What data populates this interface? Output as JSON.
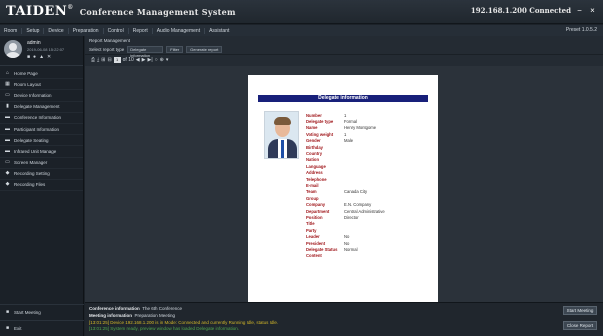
{
  "titlebar": {
    "brand": "TAIDEN",
    "brand_mark": "®",
    "title": "Conference Management System",
    "ip_info": "192.168.1.200  Connected",
    "min_glyph": "−",
    "close_glyph": "×"
  },
  "menubar": {
    "items": [
      "Room",
      "Setup",
      "Device",
      "Preparation",
      "Control",
      "Report",
      "Audio Management",
      "Assistant"
    ],
    "right": "Preset  1.0.5.2"
  },
  "user": {
    "name": "admin",
    "datetime": "2019-06-08 15:22:07",
    "icons": [
      "■",
      "●",
      "▲",
      "✕"
    ]
  },
  "sidebar": {
    "items": [
      {
        "icon": "⌂",
        "label": "Home Page"
      },
      {
        "icon": "▦",
        "label": "Room Layout"
      },
      {
        "icon": "▭",
        "label": "Device Information"
      },
      {
        "icon": "▮",
        "label": "Delegate Management"
      },
      {
        "icon": "▬",
        "label": "Conference Information"
      },
      {
        "icon": "▬",
        "label": "Participant Information"
      },
      {
        "icon": "▬",
        "label": "Delegate Seating"
      },
      {
        "icon": "▬",
        "label": "Infrared Unit Manage"
      },
      {
        "icon": "▭",
        "label": "Screen Manager"
      },
      {
        "icon": "◆",
        "label": "Recording Setting"
      },
      {
        "icon": "◆",
        "label": "Recording Files"
      }
    ],
    "bottom": [
      {
        "icon": "■",
        "label": "Start Meeting"
      },
      {
        "icon": "■",
        "label": "Exit"
      }
    ]
  },
  "main": {
    "header": "Report Management",
    "filter_label": "Select report type",
    "filter_value": "Delegate information",
    "filter_buttons": [
      "Filter",
      "Generate report"
    ],
    "pdf_toolbar": {
      "icons": [
        "⎙",
        "⤓",
        "⊞",
        "⊟"
      ],
      "page": "1",
      "page_of": "of 10",
      "nav": [
        "◀",
        "▶",
        "▶|"
      ],
      "zoom": [
        "○",
        "⊕",
        "▾"
      ]
    },
    "zoom_buttons": [
      "−",
      "+"
    ]
  },
  "document": {
    "header": "Delegate information",
    "fields": [
      {
        "label": "Number",
        "value": "1"
      },
      {
        "label": "Delegate type",
        "value": "Formal"
      },
      {
        "label": "Name",
        "value": "Henry Montgome"
      },
      {
        "label": "Voting weight",
        "value": "1"
      },
      {
        "label": "Gender",
        "value": "Male"
      },
      {
        "label": "Birthday",
        "value": ""
      },
      {
        "label": "Country",
        "value": ""
      },
      {
        "label": "Nation",
        "value": ""
      },
      {
        "label": "Language",
        "value": ""
      },
      {
        "label": "Address",
        "value": ""
      },
      {
        "label": "Telephone",
        "value": ""
      },
      {
        "label": "E-mail",
        "value": ""
      },
      {
        "label": "Team",
        "value": "Canada City"
      },
      {
        "label": "Group",
        "value": ""
      },
      {
        "label": "Company",
        "value": "E.N. Company"
      },
      {
        "label": "Department",
        "value": "Central Administrative"
      },
      {
        "label": "Position",
        "value": "Director"
      },
      {
        "label": "Title",
        "value": ""
      },
      {
        "label": "Party",
        "value": ""
      },
      {
        "label": "Leader",
        "value": "No"
      },
      {
        "label": "President",
        "value": "No"
      },
      {
        "label": "Delegate Status",
        "value": "Normal"
      },
      {
        "label": "Content",
        "value": ""
      }
    ]
  },
  "infopanel": {
    "conference_label": "Conference information",
    "conference_value": "The 6th Conference",
    "meeting_label": "Meeting information",
    "meeting_value": "Preparation Meeting",
    "log_line1": "[13:01:25] Device 192.168.1.200 is in Mode: Connected and currently Running Idle, status Idle.",
    "log_line2": "[13:01:25] System ready, preview window has loaded Delegate information.",
    "button_primary": "Start Meeting",
    "button_secondary": "Close Report"
  }
}
